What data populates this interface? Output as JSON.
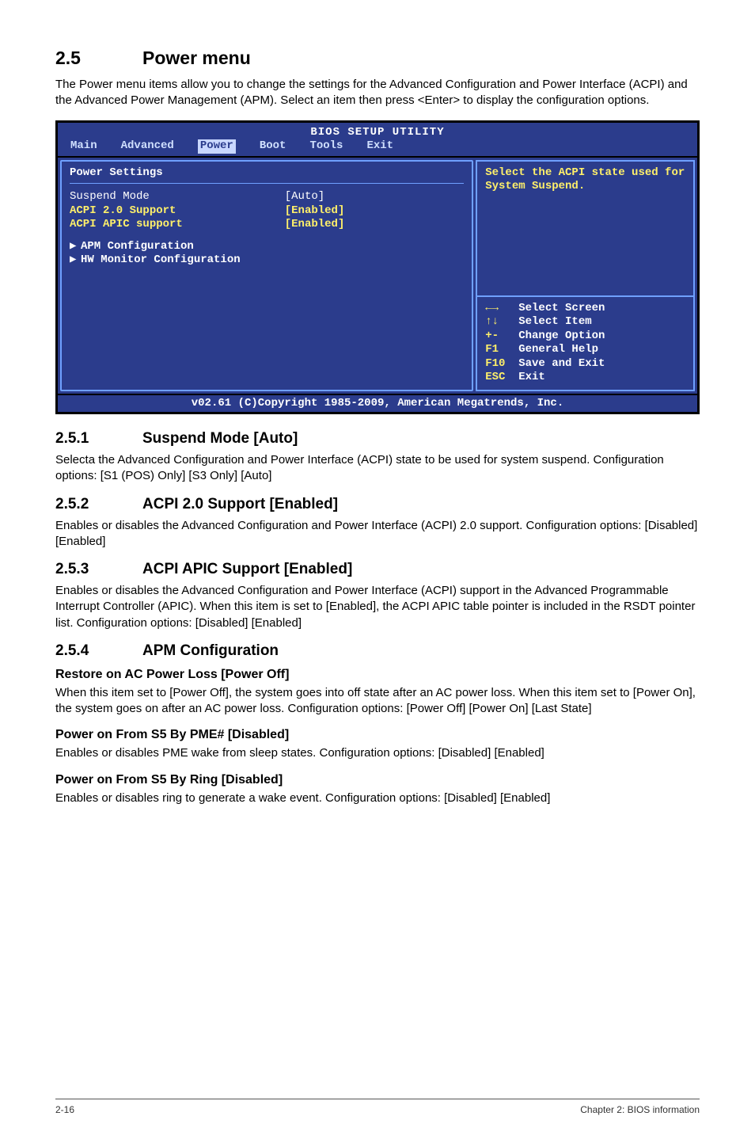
{
  "section": {
    "num": "2.5",
    "title": "Power menu"
  },
  "intro": "The Power menu items allow you to change the settings for the Advanced Configuration and Power Interface (ACPI) and the Advanced Power Management (APM). Select an item then press <Enter> to display the configuration options.",
  "bios": {
    "title": "BIOS SETUP UTILITY",
    "tabs": [
      "Main",
      "Advanced",
      "Power",
      "Boot",
      "Tools",
      "Exit"
    ],
    "active_tab_index": 2,
    "panel_title": "Power Settings",
    "rows": [
      {
        "label": "Suspend Mode",
        "val": "[Auto]",
        "selected": true
      },
      {
        "label": "ACPI 2.0 Support",
        "val": "[Enabled]",
        "yellow": true
      },
      {
        "label": "ACPI APIC support",
        "val": "[Enabled]",
        "yellow": true
      }
    ],
    "subs": [
      "APM Configuration",
      "HW Monitor Configuration"
    ],
    "help": "Select the ACPI state used for System Suspend.",
    "keys": [
      {
        "k": "←→",
        "d": "Select Screen"
      },
      {
        "k": "↑↓",
        "d": "Select Item"
      },
      {
        "k": "+-",
        "d": "Change Option"
      },
      {
        "k": "F1",
        "d": "General Help"
      },
      {
        "k": "F10",
        "d": "Save and Exit"
      },
      {
        "k": "ESC",
        "d": "Exit"
      }
    ],
    "footer": "v02.61 (C)Copyright 1985-2009, American Megatrends, Inc."
  },
  "sub": [
    {
      "num": "2.5.1",
      "title": "Suspend Mode [Auto]",
      "body": "Selecta the Advanced Configuration and Power Interface (ACPI) state to be used for system suspend. Configuration options: [S1 (POS) Only] [S3 Only] [Auto]"
    },
    {
      "num": "2.5.2",
      "title": "ACPI 2.0 Support [Enabled]",
      "body": "Enables or disables the Advanced Configuration and Power Interface (ACPI) 2.0 support. Configuration options: [Disabled] [Enabled]"
    },
    {
      "num": "2.5.3",
      "title": "ACPI APIC Support [Enabled]",
      "body": "Enables or disables the Advanced Configuration and Power Interface (ACPI) support in the Advanced Programmable Interrupt Controller (APIC). When this item is set to [Enabled], the ACPI APIC table pointer is included in the RSDT pointer list. Configuration options: [Disabled] [Enabled]"
    },
    {
      "num": "2.5.4",
      "title": "APM Configuration",
      "items": [
        {
          "h": "Restore on AC Power Loss [Power Off]",
          "b": "When this item set to [Power Off], the system goes into off state after an AC power loss. When this item set to [Power On], the system goes on after an AC power loss. Configuration options: [Power Off] [Power On] [Last State]"
        },
        {
          "h": "Power on From S5 By PME# [Disabled]",
          "b": "Enables or disables PME wake from sleep states. Configuration options: [Disabled] [Enabled]"
        },
        {
          "h": "Power on From S5 By Ring [Disabled]",
          "b": "Enables or disables ring to generate a wake event. Configuration options: [Disabled] [Enabled]"
        }
      ]
    }
  ],
  "footer": {
    "left": "2-16",
    "right": "Chapter 2: BIOS information"
  }
}
